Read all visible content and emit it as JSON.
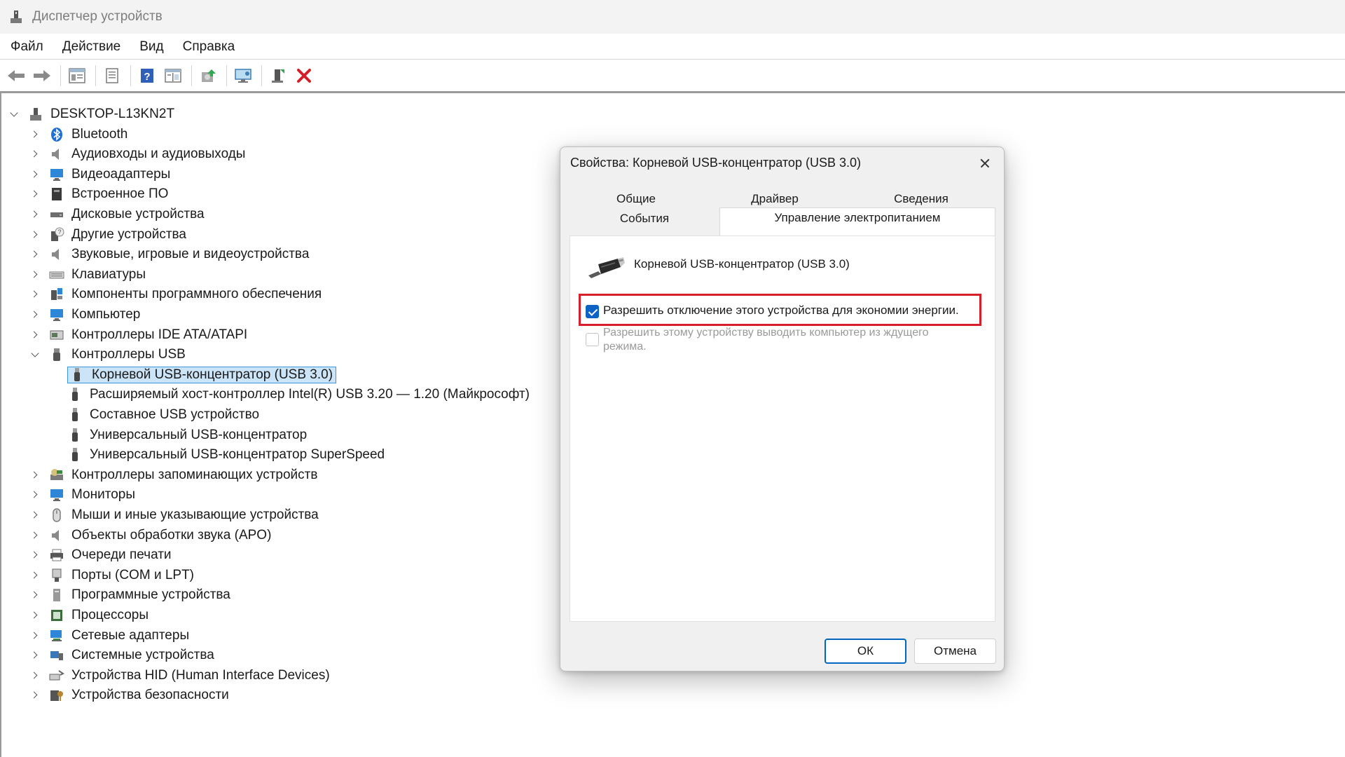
{
  "window": {
    "title": "Диспетчер устройств"
  },
  "menu": [
    "Файл",
    "Действие",
    "Вид",
    "Справка"
  ],
  "toolbar": {
    "buttons": [
      "back-icon",
      "forward-icon",
      "console-tree-icon",
      "properties-icon",
      "help-icon",
      "details-pane-icon",
      "update-driver-icon",
      "scan-hardware-icon",
      "add-legacy-icon",
      "uninstall-icon"
    ]
  },
  "tree": {
    "root": "DESKTOP-L13KN2T",
    "items": [
      {
        "label": "Bluetooth"
      },
      {
        "label": "Аудиовходы и аудиовыходы"
      },
      {
        "label": "Видеоадаптеры"
      },
      {
        "label": "Встроенное ПО"
      },
      {
        "label": "Дисковые устройства"
      },
      {
        "label": "Другие устройства"
      },
      {
        "label": "Звуковые, игровые и видеоустройства"
      },
      {
        "label": "Клавиатуры"
      },
      {
        "label": "Компоненты программного обеспечения"
      },
      {
        "label": "Компьютер"
      },
      {
        "label": "Контроллеры IDE ATA/ATAPI"
      },
      {
        "label": "Контроллеры USB",
        "expanded": true
      },
      {
        "label": "Контроллеры запоминающих устройств"
      },
      {
        "label": "Мониторы"
      },
      {
        "label": "Мыши и иные указывающие устройства"
      },
      {
        "label": "Объекты обработки звука (APO)"
      },
      {
        "label": "Очереди печати"
      },
      {
        "label": "Порты (COM и LPT)"
      },
      {
        "label": "Программные устройства"
      },
      {
        "label": "Процессоры"
      },
      {
        "label": "Сетевые адаптеры"
      },
      {
        "label": "Системные устройства"
      },
      {
        "label": "Устройства HID (Human Interface Devices)"
      },
      {
        "label": "Устройства безопасности"
      }
    ],
    "usb_children": [
      {
        "label": "Корневой USB-концентратор (USB 3.0)",
        "selected": true
      },
      {
        "label": "Расширяемый хост-контроллер Intel(R) USB 3.20 — 1.20 (Майкрософт)"
      },
      {
        "label": "Составное USB устройство"
      },
      {
        "label": "Универсальный USB-концентратор"
      },
      {
        "label": "Универсальный USB-концентратор SuperSpeed"
      }
    ]
  },
  "dialog": {
    "title": "Свойства: Корневой USB-концентратор (USB 3.0)",
    "tabs": [
      "Общие",
      "Драйвер",
      "Сведения",
      "События",
      "Управление электропитанием"
    ],
    "active_tab": "Управление электропитанием",
    "device_name": "Корневой USB-концентратор (USB 3.0)",
    "option_allow_off": {
      "label": "Разрешить отключение этого устройства для экономии энергии.",
      "checked": true
    },
    "option_wake": {
      "label": "Разрешить этому устройству выводить компьютер из ждущего режима.",
      "checked": false,
      "enabled": false
    },
    "ok": "ОК",
    "cancel": "Отмена"
  },
  "colors": {
    "highlight": "#d81e28",
    "accent": "#0067c0",
    "selection": "#cce4f7"
  }
}
